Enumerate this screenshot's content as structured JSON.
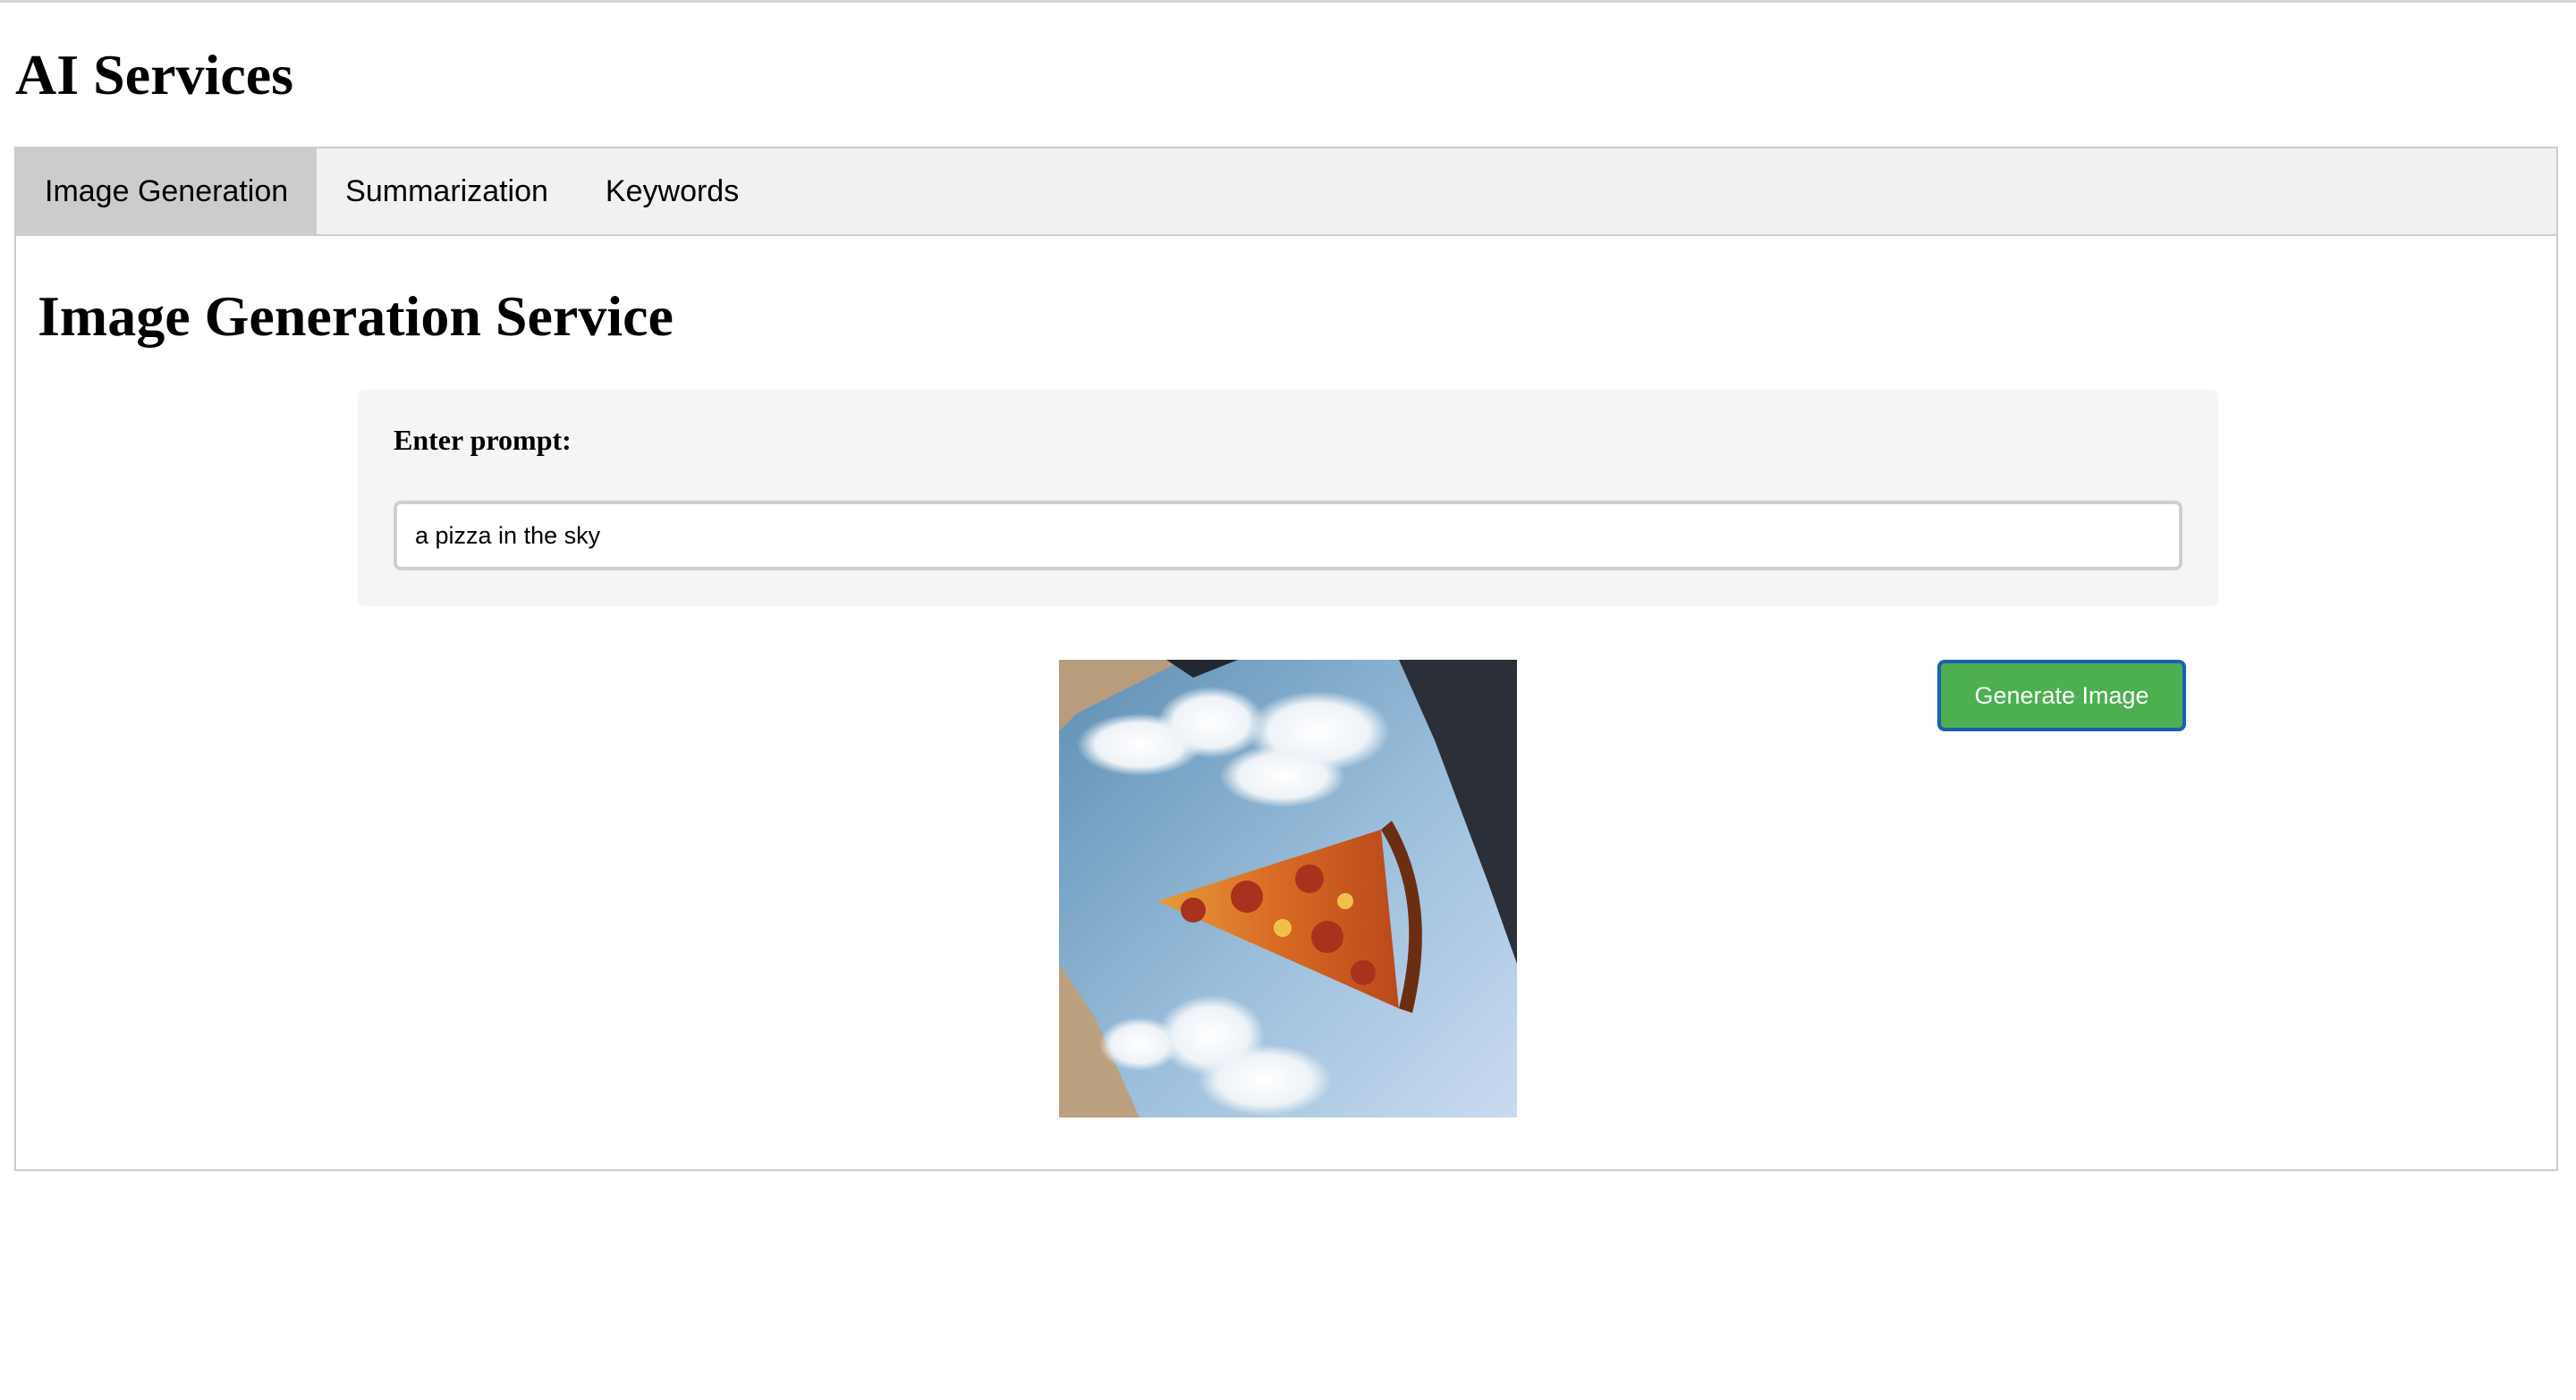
{
  "app": {
    "title": "AI Services"
  },
  "tabs": [
    {
      "label": "Image Generation",
      "active": true
    },
    {
      "label": "Summarization",
      "active": false
    },
    {
      "label": "Keywords",
      "active": false
    }
  ],
  "image_generation": {
    "heading": "Image Generation Service",
    "prompt_label": "Enter prompt:",
    "prompt_value": "a pizza in the sky",
    "generate_button_label": "Generate Image",
    "result_image_alt": "pizza-slice-in-sky-image"
  },
  "colors": {
    "active_tab_bg": "#cccccc",
    "tab_bar_bg": "#f1f1f1",
    "form_card_bg": "#f5f5f5",
    "button_bg": "#4caf50",
    "button_focus_border": "#1a5fb4"
  }
}
